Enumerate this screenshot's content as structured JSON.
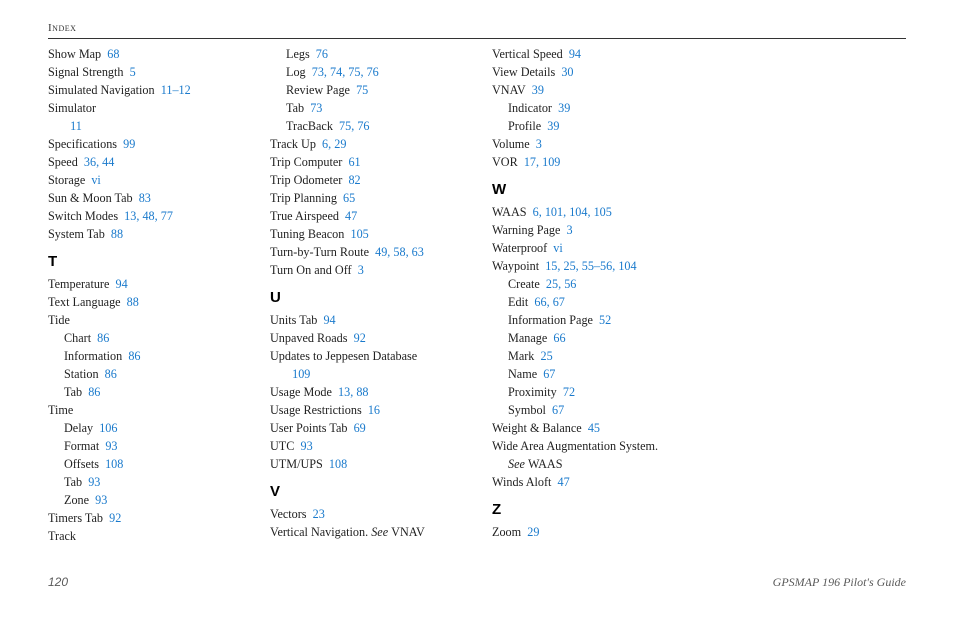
{
  "running_head": "Index",
  "page_number": "120",
  "doc_title": "GPSMAP 196 Pilot's Guide",
  "blocks": [
    {
      "t": "entry",
      "term": "Show Map",
      "refs": "68"
    },
    {
      "t": "entry",
      "term": "Signal Strength",
      "refs": "5"
    },
    {
      "t": "entry",
      "term": "Simulated Navigation",
      "refs": "11–12"
    },
    {
      "t": "entry",
      "term": "Simulator",
      "refs": ""
    },
    {
      "t": "sub",
      "term": "",
      "refs": "11"
    },
    {
      "t": "entry",
      "term": "Specifications",
      "refs": "99"
    },
    {
      "t": "entry",
      "term": "Speed",
      "refs": "36, 44"
    },
    {
      "t": "entry",
      "term": "Storage",
      "refs": "vi"
    },
    {
      "t": "entry",
      "term": "Sun & Moon Tab",
      "refs": "83"
    },
    {
      "t": "entry",
      "term": "Switch Modes",
      "refs": "13, 48, 77"
    },
    {
      "t": "entry",
      "term": "System Tab",
      "refs": "88"
    },
    {
      "t": "letter",
      "term": "T"
    },
    {
      "t": "entry",
      "term": "Temperature",
      "refs": "94"
    },
    {
      "t": "entry",
      "term": "Text Language",
      "refs": "88"
    },
    {
      "t": "entry",
      "term": "Tide",
      "refs": ""
    },
    {
      "t": "sub",
      "term": "Chart",
      "refs": "86"
    },
    {
      "t": "sub",
      "term": "Information",
      "refs": "86"
    },
    {
      "t": "sub",
      "term": "Station",
      "refs": "86"
    },
    {
      "t": "sub",
      "term": "Tab",
      "refs": "86"
    },
    {
      "t": "entry",
      "term": "Time",
      "refs": ""
    },
    {
      "t": "sub",
      "term": "Delay",
      "refs": "106"
    },
    {
      "t": "sub",
      "term": "Format",
      "refs": "93"
    },
    {
      "t": "sub",
      "term": "Offsets",
      "refs": "108"
    },
    {
      "t": "sub",
      "term": "Tab",
      "refs": "93"
    },
    {
      "t": "sub",
      "term": "Zone",
      "refs": "93"
    },
    {
      "t": "entry",
      "term": "Timers Tab",
      "refs": "92"
    },
    {
      "t": "entry",
      "term": "Track",
      "refs": ""
    },
    {
      "t": "sub",
      "term": "Legs",
      "refs": "76"
    },
    {
      "t": "sub",
      "term": "Log",
      "refs": "73, 74, 75, 76"
    },
    {
      "t": "sub",
      "term": "Review Page",
      "refs": "75"
    },
    {
      "t": "sub",
      "term": "Tab",
      "refs": "73"
    },
    {
      "t": "sub",
      "term": "TracBack",
      "refs": "75, 76"
    },
    {
      "t": "entry",
      "term": "Track Up",
      "refs": "6, 29"
    },
    {
      "t": "entry",
      "term": "Trip Computer",
      "refs": "61"
    },
    {
      "t": "entry",
      "term": "Trip Odometer",
      "refs": "82"
    },
    {
      "t": "entry",
      "term": "Trip Planning",
      "refs": "65"
    },
    {
      "t": "entry",
      "term": "True Airspeed",
      "refs": "47"
    },
    {
      "t": "entry",
      "term": "Tuning Beacon",
      "refs": "105"
    },
    {
      "t": "entry",
      "term": "Turn-by-Turn Route",
      "refs": "49, 58, 63"
    },
    {
      "t": "entry",
      "term": "Turn On and Off",
      "refs": "3"
    },
    {
      "t": "letter",
      "term": "U"
    },
    {
      "t": "entry",
      "term": "Units Tab",
      "refs": "94"
    },
    {
      "t": "entry",
      "term": "Unpaved Roads",
      "refs": "92"
    },
    {
      "t": "entry",
      "term": "Updates to Jeppesen Database",
      "refs": ""
    },
    {
      "t": "sub",
      "term": "",
      "refs": "109"
    },
    {
      "t": "entry",
      "term": "Usage Mode",
      "refs": "13, 88"
    },
    {
      "t": "entry",
      "term": "Usage Restrictions",
      "refs": "16"
    },
    {
      "t": "entry",
      "term": "User Points Tab",
      "refs": "69"
    },
    {
      "t": "entry",
      "term": "UTC",
      "refs": "93"
    },
    {
      "t": "entry",
      "term": "UTM/UPS",
      "refs": "108"
    },
    {
      "t": "letter",
      "term": "V"
    },
    {
      "t": "entry",
      "term": "Vectors",
      "refs": "23"
    },
    {
      "t": "see-entry",
      "term": "Vertical Navigation.",
      "see": "See",
      "target": "VNAV"
    },
    {
      "t": "entry",
      "term": "Vertical Speed",
      "refs": "94"
    },
    {
      "t": "entry",
      "term": "View Details",
      "refs": "30"
    },
    {
      "t": "entry",
      "term": "VNAV",
      "refs": "39"
    },
    {
      "t": "sub",
      "term": "Indicator",
      "refs": "39"
    },
    {
      "t": "sub",
      "term": "Profile",
      "refs": "39"
    },
    {
      "t": "entry",
      "term": "Volume",
      "refs": "3"
    },
    {
      "t": "entry",
      "term": "VOR",
      "refs": "17, 109"
    },
    {
      "t": "letter",
      "term": "W"
    },
    {
      "t": "entry",
      "term": "WAAS",
      "refs": "6, 101, 104, 105"
    },
    {
      "t": "entry",
      "term": "Warning Page",
      "refs": "3"
    },
    {
      "t": "entry",
      "term": "Waterproof",
      "refs": "vi"
    },
    {
      "t": "entry",
      "term": "Waypoint",
      "refs": "15, 25, 55–56, 104"
    },
    {
      "t": "sub",
      "term": "Create",
      "refs": "25, 56"
    },
    {
      "t": "sub",
      "term": "Edit",
      "refs": "66, 67"
    },
    {
      "t": "sub",
      "term": "Information Page",
      "refs": "52"
    },
    {
      "t": "sub",
      "term": "Manage",
      "refs": "66"
    },
    {
      "t": "sub",
      "term": "Mark",
      "refs": "25"
    },
    {
      "t": "sub",
      "term": "Name",
      "refs": "67"
    },
    {
      "t": "sub",
      "term": "Proximity",
      "refs": "72"
    },
    {
      "t": "sub",
      "term": "Symbol",
      "refs": "67"
    },
    {
      "t": "entry",
      "term": "Weight & Balance",
      "refs": "45"
    },
    {
      "t": "entry",
      "term": "Wide Area Augmentation System.",
      "refs": ""
    },
    {
      "t": "sub-see",
      "see": "See",
      "target": "WAAS"
    },
    {
      "t": "entry",
      "term": "Winds Aloft",
      "refs": "47"
    },
    {
      "t": "letter",
      "term": "Z"
    },
    {
      "t": "entry",
      "term": "Zoom",
      "refs": "29"
    }
  ]
}
